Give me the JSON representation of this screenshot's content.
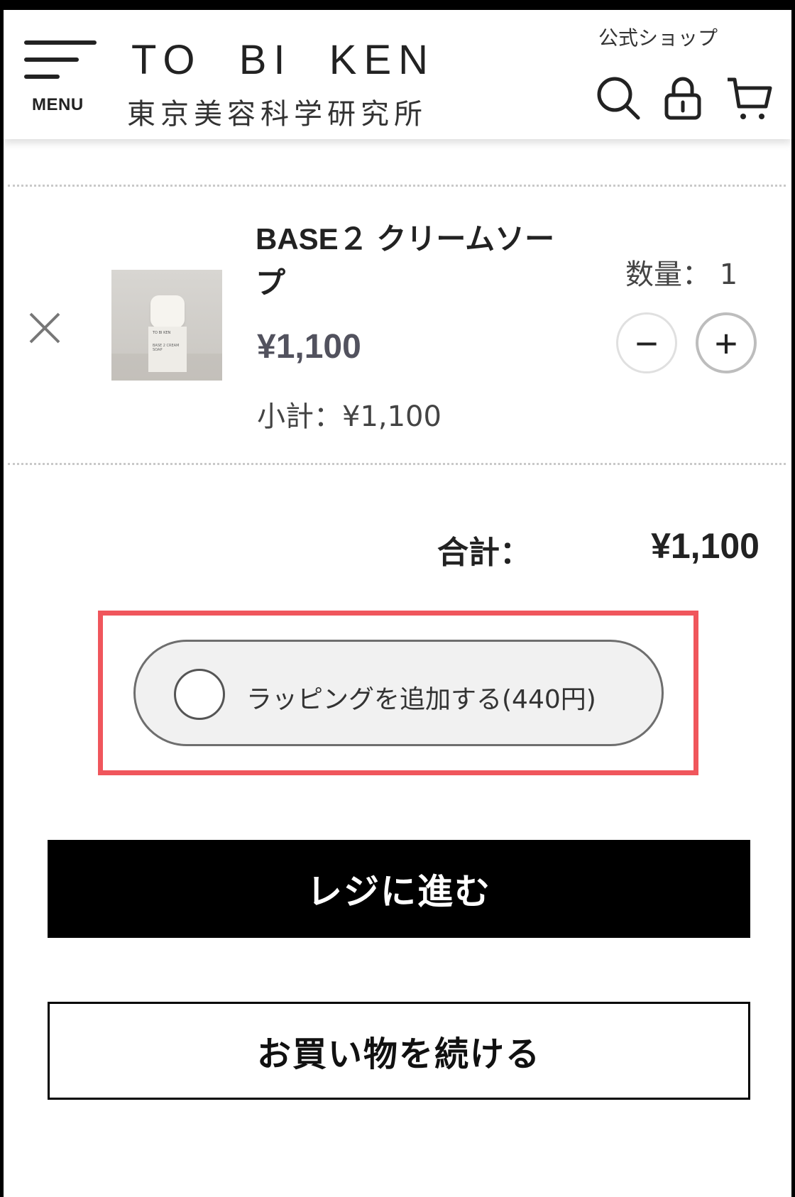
{
  "header": {
    "menu_label": "MENU",
    "brand_en": "TO  BI  KEN",
    "brand_jp": "東京美容科学研究所",
    "official_shop": "公式ショップ",
    "icons": [
      "search-icon",
      "lock-icon",
      "cart-icon"
    ]
  },
  "cart": {
    "items": [
      {
        "name": "BASE２ クリームソープ",
        "price": "¥1,100",
        "subtotal": "小計：¥1,100",
        "quantity_label": "数量： 1",
        "thumb_brand": "TO BI KEN",
        "thumb_text": "BASE 2 CREAM SOAP"
      }
    ],
    "total_label": "合計：",
    "total_value": "¥1,100"
  },
  "wrapping": {
    "label": "ラッピングを追加する(440円)",
    "checked": false
  },
  "buttons": {
    "checkout": "レジに進む",
    "continue": "お買い物を続ける"
  },
  "colors": {
    "highlight": "#f0565c",
    "price": "#52525e",
    "checkout_bg": "#000000"
  }
}
